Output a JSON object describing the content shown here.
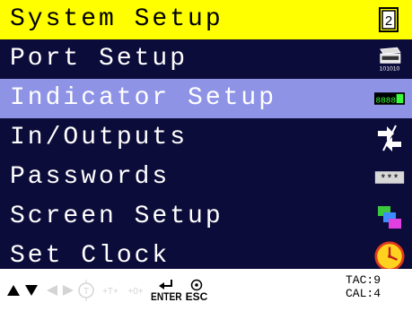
{
  "menu": {
    "title": "System Setup",
    "items": [
      {
        "label": "Port Setup",
        "icon": "serial-port-icon",
        "icon_text": "101010"
      },
      {
        "label": "Indicator Setup",
        "icon": "indicator-display-icon",
        "icon_text": "8888",
        "selected": true
      },
      {
        "label": "In/Outputs",
        "icon": "in-out-arrows-icon"
      },
      {
        "label": "Passwords",
        "icon": "password-mask-icon",
        "icon_text": "***"
      },
      {
        "label": "Screen Setup",
        "icon": "overlapping-windows-icon"
      },
      {
        "label": "Set Clock",
        "icon": "clock-icon"
      }
    ],
    "title_icon": "page-number-icon",
    "title_icon_text": "2"
  },
  "footer": {
    "enter_label": "ENTER",
    "esc_label": "ESC",
    "tac": "TAC:9",
    "cal": "CAL:4"
  },
  "colors": {
    "title_bg": "#ffff00",
    "screen_bg": "#0c0c3a",
    "selected_bg": "#8f93e6"
  }
}
